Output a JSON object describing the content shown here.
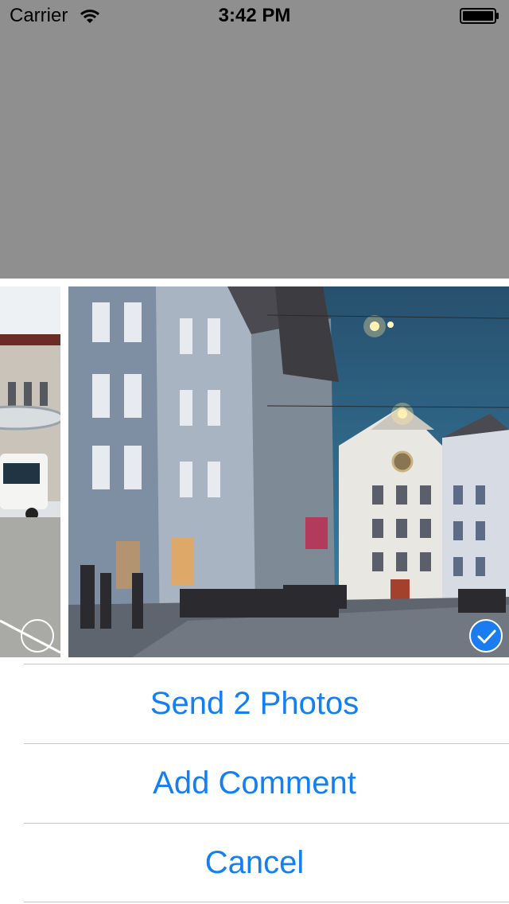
{
  "status_bar": {
    "carrier": "Carrier",
    "time": "3:42 PM",
    "wifi_icon": "wifi-icon",
    "battery_icon": "battery-full-icon"
  },
  "photos": [
    {
      "name": "bus-station-photo",
      "selected": false
    },
    {
      "name": "town-square-photo",
      "selected": true
    }
  ],
  "actions": {
    "send_label": "Send 2 Photos",
    "comment_label": "Add Comment",
    "cancel_label": "Cancel"
  },
  "colors": {
    "accent": "#137ff0",
    "dim_background": "#8f8f8f",
    "separator": "#c8c8cc",
    "checkmark_fill": "#1a7cf0"
  }
}
